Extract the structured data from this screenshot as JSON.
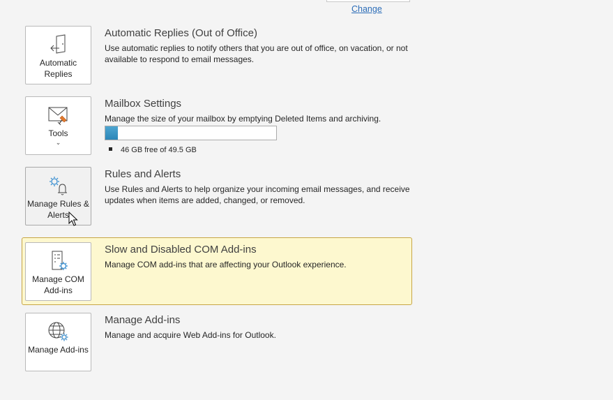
{
  "header": {
    "change_link": "Change"
  },
  "sections": [
    {
      "tile_label": "Automatic Replies",
      "title": "Automatic Replies (Out of Office)",
      "description": "Use automatic replies to notify others that you are out of office, on vacation, or not available to respond to email messages.",
      "icon": "door-arrow-icon"
    },
    {
      "tile_label": "Tools",
      "tile_chevron": "⌄",
      "title": "Mailbox Settings",
      "description": "Manage the size of your mailbox by emptying Deleted Items and archiving.",
      "icon": "mail-broom-icon",
      "storage": {
        "used_fraction": 0.072,
        "label": "46 GB free of 49.5 GB"
      }
    },
    {
      "tile_label": "Manage Rules & Alerts",
      "title": "Rules and Alerts",
      "description": "Use Rules and Alerts to help organize your incoming email messages, and receive updates when items are added, changed, or removed.",
      "icon": "gear-bell-icon"
    },
    {
      "tile_label": "Manage COM Add-ins",
      "title": "Slow and Disabled COM Add-ins",
      "description": "Manage COM add-ins that are affecting your Outlook experience.",
      "icon": "document-gear-icon",
      "highlighted": true
    },
    {
      "tile_label": "Manage Add-ins",
      "title": "Manage Add-ins",
      "description": "Manage and acquire Web Add-ins for Outlook.",
      "icon": "globe-gear-icon"
    }
  ],
  "colors": {
    "accent_blue": "#2b86b8",
    "highlight_bg": "#fdf8cf",
    "highlight_border": "#c7a545",
    "link": "#2b6cb7",
    "gear_blue": "#3a8fd0",
    "orange": "#e07a2e"
  }
}
